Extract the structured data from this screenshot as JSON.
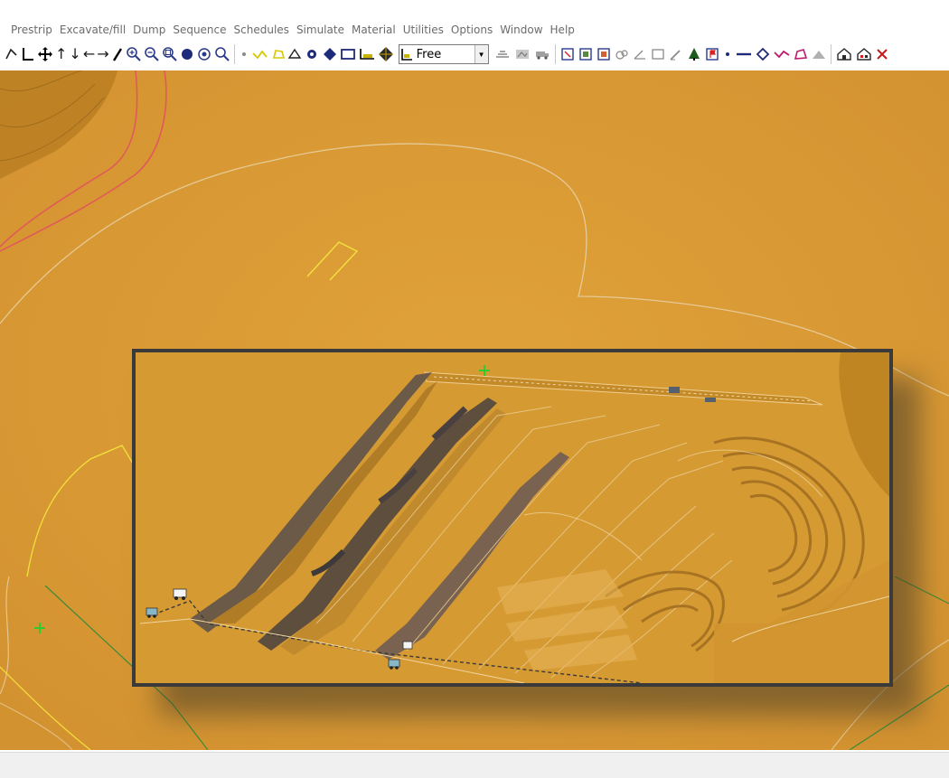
{
  "menu": {
    "items": [
      "Prestrip",
      "Excavate/fill",
      "Dump",
      "Sequence",
      "Schedules",
      "Simulate",
      "Material",
      "Utilities",
      "Options",
      "Window",
      "Help"
    ]
  },
  "toolbar": {
    "view_mode": "Free"
  },
  "colors": {
    "terrain": "#dd9d35",
    "terrain_inset": "#d49630",
    "inset_border": "#3a3a3a",
    "contour_red": "#e05a5a",
    "contour_yellow": "#f2e23a",
    "contour_green": "#3f8a3a",
    "contour_white": "#e8d2a6"
  },
  "icons": {
    "left_group": [
      "lasso-icon",
      "axis-icon",
      "pan-icon",
      "arrow-up-icon",
      "arrow-down-icon",
      "arrow-left-icon",
      "arrow-right-icon",
      "pencil-icon",
      "zoom-in-icon",
      "zoom-out-icon",
      "zoom-window-icon",
      "sphere-icon",
      "target-icon",
      "zoom-extents-icon"
    ],
    "draw_group": [
      "point-icon",
      "polyline-icon",
      "polygon-icon",
      "triangle-icon",
      "gear-icon",
      "diamond-fill-icon",
      "rectangle-icon",
      "grid-icon",
      "diamond-icon"
    ],
    "right_group": [
      "layers-icon",
      "map-icon",
      "truck-icon",
      "select-icon",
      "frame-icon",
      "box-icon",
      "link-icon",
      "measure-icon",
      "window-icon",
      "edit-icon",
      "tree-icon",
      "flag-icon",
      "dot-icon",
      "line-icon",
      "vertex-icon",
      "zigzag-icon",
      "shape-icon",
      "mountain-icon",
      "house-icon",
      "house-2-icon",
      "close-icon"
    ]
  }
}
